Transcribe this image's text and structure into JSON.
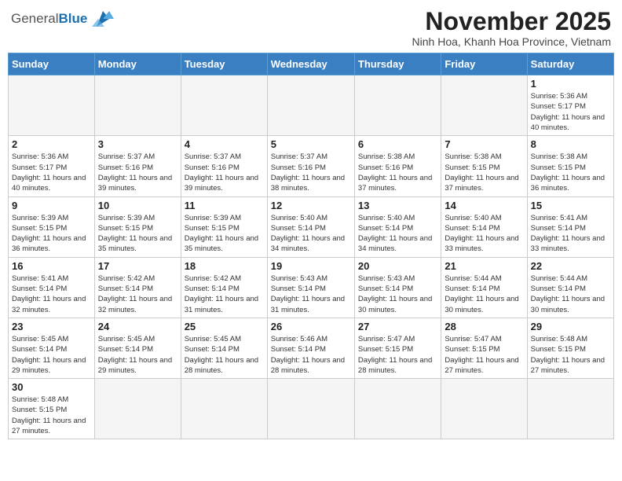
{
  "header": {
    "logo_general": "General",
    "logo_blue": "Blue",
    "month": "November 2025",
    "location": "Ninh Hoa, Khanh Hoa Province, Vietnam"
  },
  "days_of_week": [
    "Sunday",
    "Monday",
    "Tuesday",
    "Wednesday",
    "Thursday",
    "Friday",
    "Saturday"
  ],
  "weeks": [
    [
      {
        "day": "",
        "info": ""
      },
      {
        "day": "",
        "info": ""
      },
      {
        "day": "",
        "info": ""
      },
      {
        "day": "",
        "info": ""
      },
      {
        "day": "",
        "info": ""
      },
      {
        "day": "",
        "info": ""
      },
      {
        "day": "1",
        "info": "Sunrise: 5:36 AM\nSunset: 5:17 PM\nDaylight: 11 hours and 40 minutes."
      }
    ],
    [
      {
        "day": "2",
        "info": "Sunrise: 5:36 AM\nSunset: 5:17 PM\nDaylight: 11 hours and 40 minutes."
      },
      {
        "day": "3",
        "info": "Sunrise: 5:37 AM\nSunset: 5:16 PM\nDaylight: 11 hours and 39 minutes."
      },
      {
        "day": "4",
        "info": "Sunrise: 5:37 AM\nSunset: 5:16 PM\nDaylight: 11 hours and 39 minutes."
      },
      {
        "day": "5",
        "info": "Sunrise: 5:37 AM\nSunset: 5:16 PM\nDaylight: 11 hours and 38 minutes."
      },
      {
        "day": "6",
        "info": "Sunrise: 5:38 AM\nSunset: 5:16 PM\nDaylight: 11 hours and 37 minutes."
      },
      {
        "day": "7",
        "info": "Sunrise: 5:38 AM\nSunset: 5:15 PM\nDaylight: 11 hours and 37 minutes."
      },
      {
        "day": "8",
        "info": "Sunrise: 5:38 AM\nSunset: 5:15 PM\nDaylight: 11 hours and 36 minutes."
      }
    ],
    [
      {
        "day": "9",
        "info": "Sunrise: 5:39 AM\nSunset: 5:15 PM\nDaylight: 11 hours and 36 minutes."
      },
      {
        "day": "10",
        "info": "Sunrise: 5:39 AM\nSunset: 5:15 PM\nDaylight: 11 hours and 35 minutes."
      },
      {
        "day": "11",
        "info": "Sunrise: 5:39 AM\nSunset: 5:15 PM\nDaylight: 11 hours and 35 minutes."
      },
      {
        "day": "12",
        "info": "Sunrise: 5:40 AM\nSunset: 5:14 PM\nDaylight: 11 hours and 34 minutes."
      },
      {
        "day": "13",
        "info": "Sunrise: 5:40 AM\nSunset: 5:14 PM\nDaylight: 11 hours and 34 minutes."
      },
      {
        "day": "14",
        "info": "Sunrise: 5:40 AM\nSunset: 5:14 PM\nDaylight: 11 hours and 33 minutes."
      },
      {
        "day": "15",
        "info": "Sunrise: 5:41 AM\nSunset: 5:14 PM\nDaylight: 11 hours and 33 minutes."
      }
    ],
    [
      {
        "day": "16",
        "info": "Sunrise: 5:41 AM\nSunset: 5:14 PM\nDaylight: 11 hours and 32 minutes."
      },
      {
        "day": "17",
        "info": "Sunrise: 5:42 AM\nSunset: 5:14 PM\nDaylight: 11 hours and 32 minutes."
      },
      {
        "day": "18",
        "info": "Sunrise: 5:42 AM\nSunset: 5:14 PM\nDaylight: 11 hours and 31 minutes."
      },
      {
        "day": "19",
        "info": "Sunrise: 5:43 AM\nSunset: 5:14 PM\nDaylight: 11 hours and 31 minutes."
      },
      {
        "day": "20",
        "info": "Sunrise: 5:43 AM\nSunset: 5:14 PM\nDaylight: 11 hours and 30 minutes."
      },
      {
        "day": "21",
        "info": "Sunrise: 5:44 AM\nSunset: 5:14 PM\nDaylight: 11 hours and 30 minutes."
      },
      {
        "day": "22",
        "info": "Sunrise: 5:44 AM\nSunset: 5:14 PM\nDaylight: 11 hours and 30 minutes."
      }
    ],
    [
      {
        "day": "23",
        "info": "Sunrise: 5:45 AM\nSunset: 5:14 PM\nDaylight: 11 hours and 29 minutes."
      },
      {
        "day": "24",
        "info": "Sunrise: 5:45 AM\nSunset: 5:14 PM\nDaylight: 11 hours and 29 minutes."
      },
      {
        "day": "25",
        "info": "Sunrise: 5:45 AM\nSunset: 5:14 PM\nDaylight: 11 hours and 28 minutes."
      },
      {
        "day": "26",
        "info": "Sunrise: 5:46 AM\nSunset: 5:14 PM\nDaylight: 11 hours and 28 minutes."
      },
      {
        "day": "27",
        "info": "Sunrise: 5:47 AM\nSunset: 5:15 PM\nDaylight: 11 hours and 28 minutes."
      },
      {
        "day": "28",
        "info": "Sunrise: 5:47 AM\nSunset: 5:15 PM\nDaylight: 11 hours and 27 minutes."
      },
      {
        "day": "29",
        "info": "Sunrise: 5:48 AM\nSunset: 5:15 PM\nDaylight: 11 hours and 27 minutes."
      }
    ],
    [
      {
        "day": "30",
        "info": "Sunrise: 5:48 AM\nSunset: 5:15 PM\nDaylight: 11 hours and 27 minutes."
      },
      {
        "day": "",
        "info": ""
      },
      {
        "day": "",
        "info": ""
      },
      {
        "day": "",
        "info": ""
      },
      {
        "day": "",
        "info": ""
      },
      {
        "day": "",
        "info": ""
      },
      {
        "day": "",
        "info": ""
      }
    ]
  ]
}
